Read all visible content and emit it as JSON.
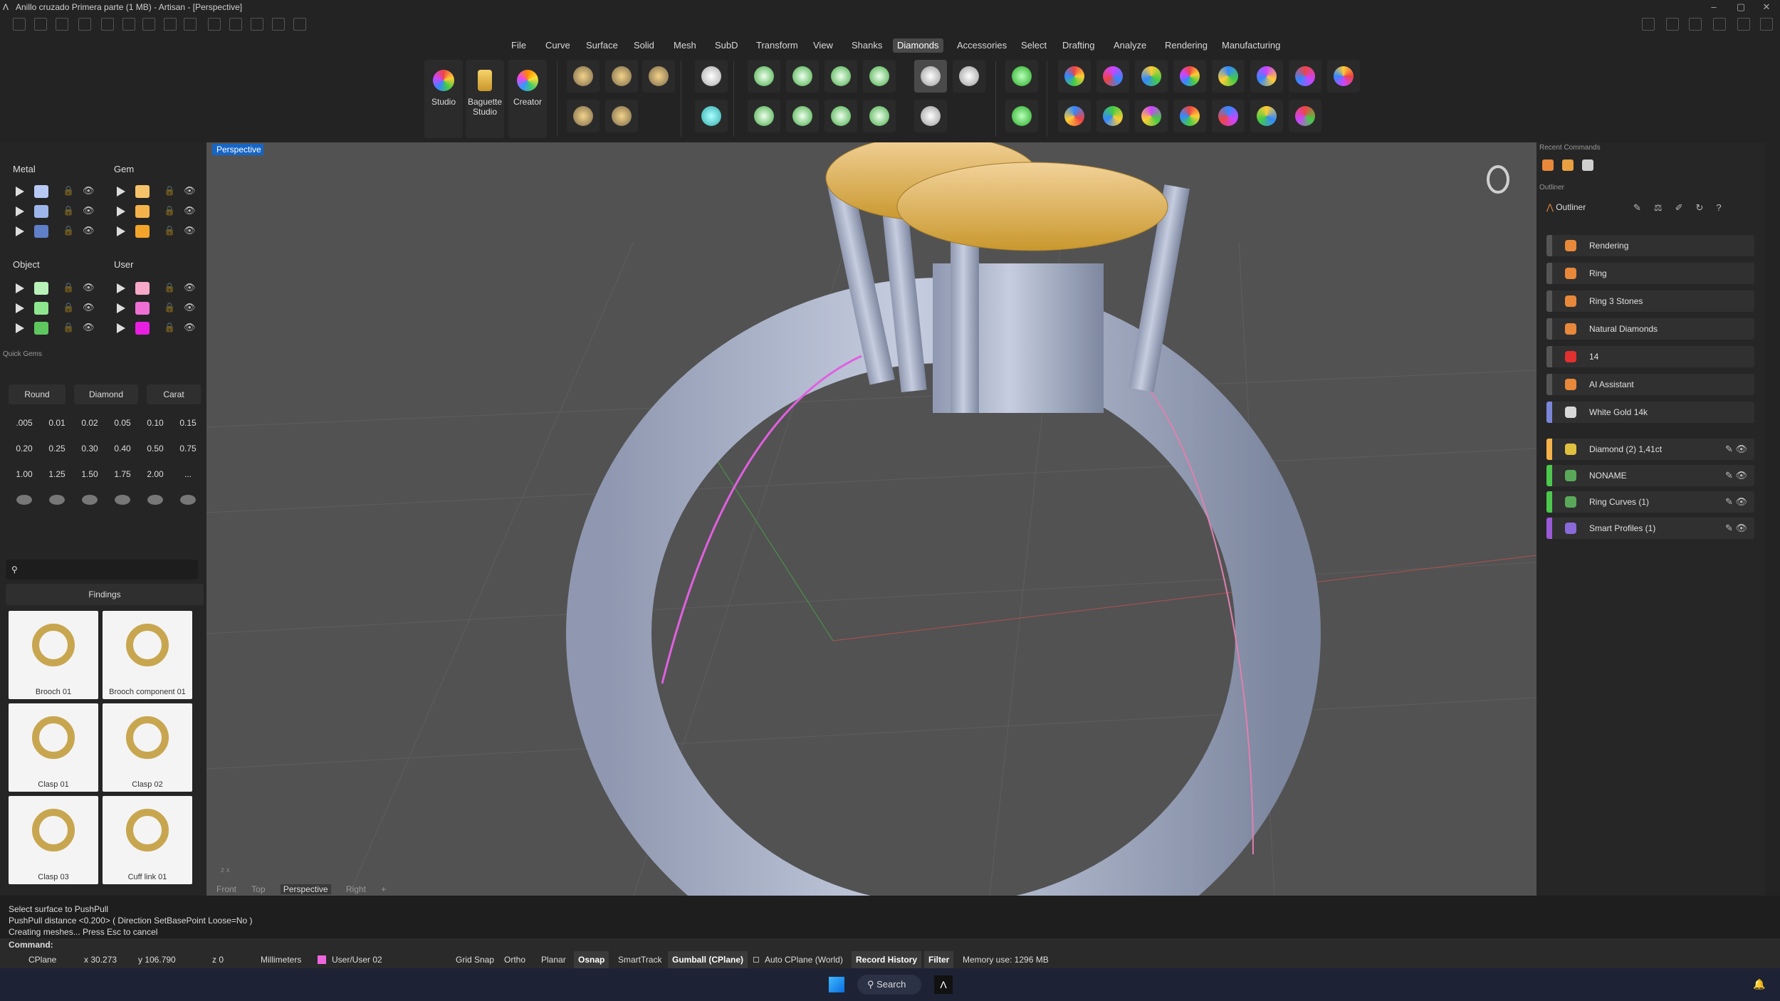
{
  "window": {
    "title": "Anillo cruzado Primera parte (1 MB) - Artisan - [Perspective]",
    "minimize": "–",
    "maximize": "▢",
    "close": "✕"
  },
  "menu": [
    "File",
    "Curve",
    "Surface",
    "Solid",
    "Mesh",
    "SubD",
    "Transform",
    "View",
    "Shanks",
    "Diamonds",
    "Accessories",
    "Select",
    "Drafting",
    "Analyze",
    "Rendering",
    "Manufacturing"
  ],
  "menu_active": "Diamonds",
  "ribbon": {
    "studio": "Studio",
    "baguette_l1": "Baguette",
    "baguette_l2": "Studio",
    "creator": "Creator"
  },
  "layers": {
    "metal": {
      "label": "Metal",
      "colors": [
        "#b7c9f3",
        "#9db6ea",
        "#5f7fc8"
      ]
    },
    "gem": {
      "label": "Gem",
      "colors": [
        "#f6c36a",
        "#f4b34a",
        "#f2a42a"
      ]
    },
    "object": {
      "label": "Object",
      "colors": [
        "#b9f2b9",
        "#8ee68e",
        "#5ec85e"
      ]
    },
    "user": {
      "label": "User",
      "colors": [
        "#f6a9c9",
        "#ef6fd5",
        "#e81ee0"
      ]
    }
  },
  "quick_gems": {
    "title": "Quick Gems",
    "shape": "Round",
    "material": "Diamond",
    "unit": "Carat",
    "sizes": [
      ".005",
      "0.01",
      "0.02",
      "0.05",
      "0.10",
      "0.15",
      "0.20",
      "0.25",
      "0.30",
      "0.40",
      "0.50",
      "0.75",
      "1.00",
      "1.25",
      "1.50",
      "1.75",
      "2.00",
      "..."
    ]
  },
  "library": {
    "category": "Findings",
    "search_placeholder": "",
    "items": [
      "Brooch 01",
      "Brooch component 01",
      "Clasp 01",
      "Clasp 02",
      "Clasp 03",
      "Cuff link 01"
    ]
  },
  "viewport": {
    "active_tab": "Perspective",
    "tabs": [
      "Front",
      "Top",
      "Perspective",
      "Right",
      "+"
    ],
    "axis_y": "z",
    "axis_x": "x"
  },
  "recent_commands_title": "Recent Commands",
  "outliner": {
    "section": "Outliner",
    "title": "Outliner",
    "top_items": [
      {
        "label": "Rendering",
        "bar": "#555555",
        "icon": "#e8883a"
      },
      {
        "label": "Ring",
        "bar": "#555555",
        "icon": "#e8883a"
      },
      {
        "label": "Ring 3 Stones",
        "bar": "#555555",
        "icon": "#e8883a"
      },
      {
        "label": "Natural Diamonds",
        "bar": "#555555",
        "icon": "#e8883a"
      },
      {
        "label": "14",
        "bar": "#555555",
        "icon": "#e03030"
      },
      {
        "label": "AI Assistant",
        "bar": "#555555",
        "icon": "#e8883a"
      },
      {
        "label": "White Gold 14k",
        "bar": "#7a86d8",
        "icon": "#d8d8d8"
      }
    ],
    "layer_items": [
      {
        "label": "Diamond (2) 1,41ct",
        "bar": "#f4b34a",
        "icon": "#e0c040"
      },
      {
        "label": "NONAME",
        "bar": "#4cc84c",
        "icon": "#5aa85a"
      },
      {
        "label": "Ring Curves (1)",
        "bar": "#4cc84c",
        "icon": "#5aa85a"
      },
      {
        "label": "Smart Profiles (1)",
        "bar": "#9a5ad8",
        "icon": "#8a6ad8"
      }
    ]
  },
  "command": {
    "lines": [
      "Select surface to PushPull",
      "PushPull distance <0.200> ( Direction  SetBasePoint  Loose=No )",
      "Creating meshes... Press Esc to cancel"
    ],
    "prompt": "Command:"
  },
  "status": {
    "cplane": "CPlane",
    "x": "x 30.273",
    "y": "y 106.790",
    "z": "z 0",
    "units": "Millimeters",
    "layer": "User/User 02",
    "grid_snap": "Grid Snap",
    "ortho": "Ortho",
    "planar": "Planar",
    "osnap": "Osnap",
    "smarttrack": "SmartTrack",
    "gumball": "Gumball (CPlane)",
    "auto_cplane": "Auto CPlane (World)",
    "record_history": "Record History",
    "filter": "Filter",
    "memory": "Memory use: 1296 MB"
  },
  "taskbar": {
    "search": "Search"
  }
}
